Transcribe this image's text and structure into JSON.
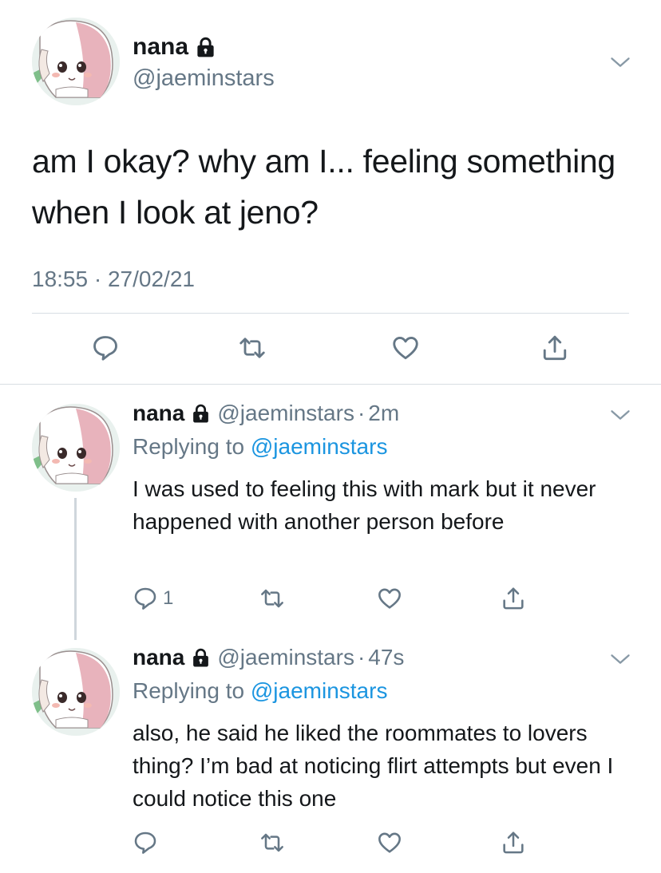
{
  "main_tweet": {
    "display_name": "nana",
    "handle": "@jaeminstars",
    "text": "am I okay? why am I... feeling something when I look at jeno?",
    "time": "18:55",
    "date": "27/02/21"
  },
  "replies": [
    {
      "display_name": "nana",
      "handle": "@jaeminstars",
      "age": "2m",
      "replying_prefix": "Replying to",
      "replying_to": "@jaeminstars",
      "text": "I was used to feeling this with mark but it never happened with another person before",
      "reply_count": "1"
    },
    {
      "display_name": "nana",
      "handle": "@jaeminstars",
      "age": "47s",
      "replying_prefix": "Replying to",
      "replying_to": "@jaeminstars",
      "text": "also, he said he liked the roommates to lovers thing? I’m bad at noticing flirt attempts but even I could notice this one",
      "reply_count": ""
    }
  ],
  "separator": "·",
  "icons": [
    "lock-icon",
    "chevron-down-icon",
    "reply-icon",
    "retweet-icon",
    "like-icon",
    "share-icon"
  ],
  "colors": {
    "text": "#14171a",
    "secondary": "#657786",
    "link": "#1b95e0",
    "divider": "#d8dee3"
  }
}
